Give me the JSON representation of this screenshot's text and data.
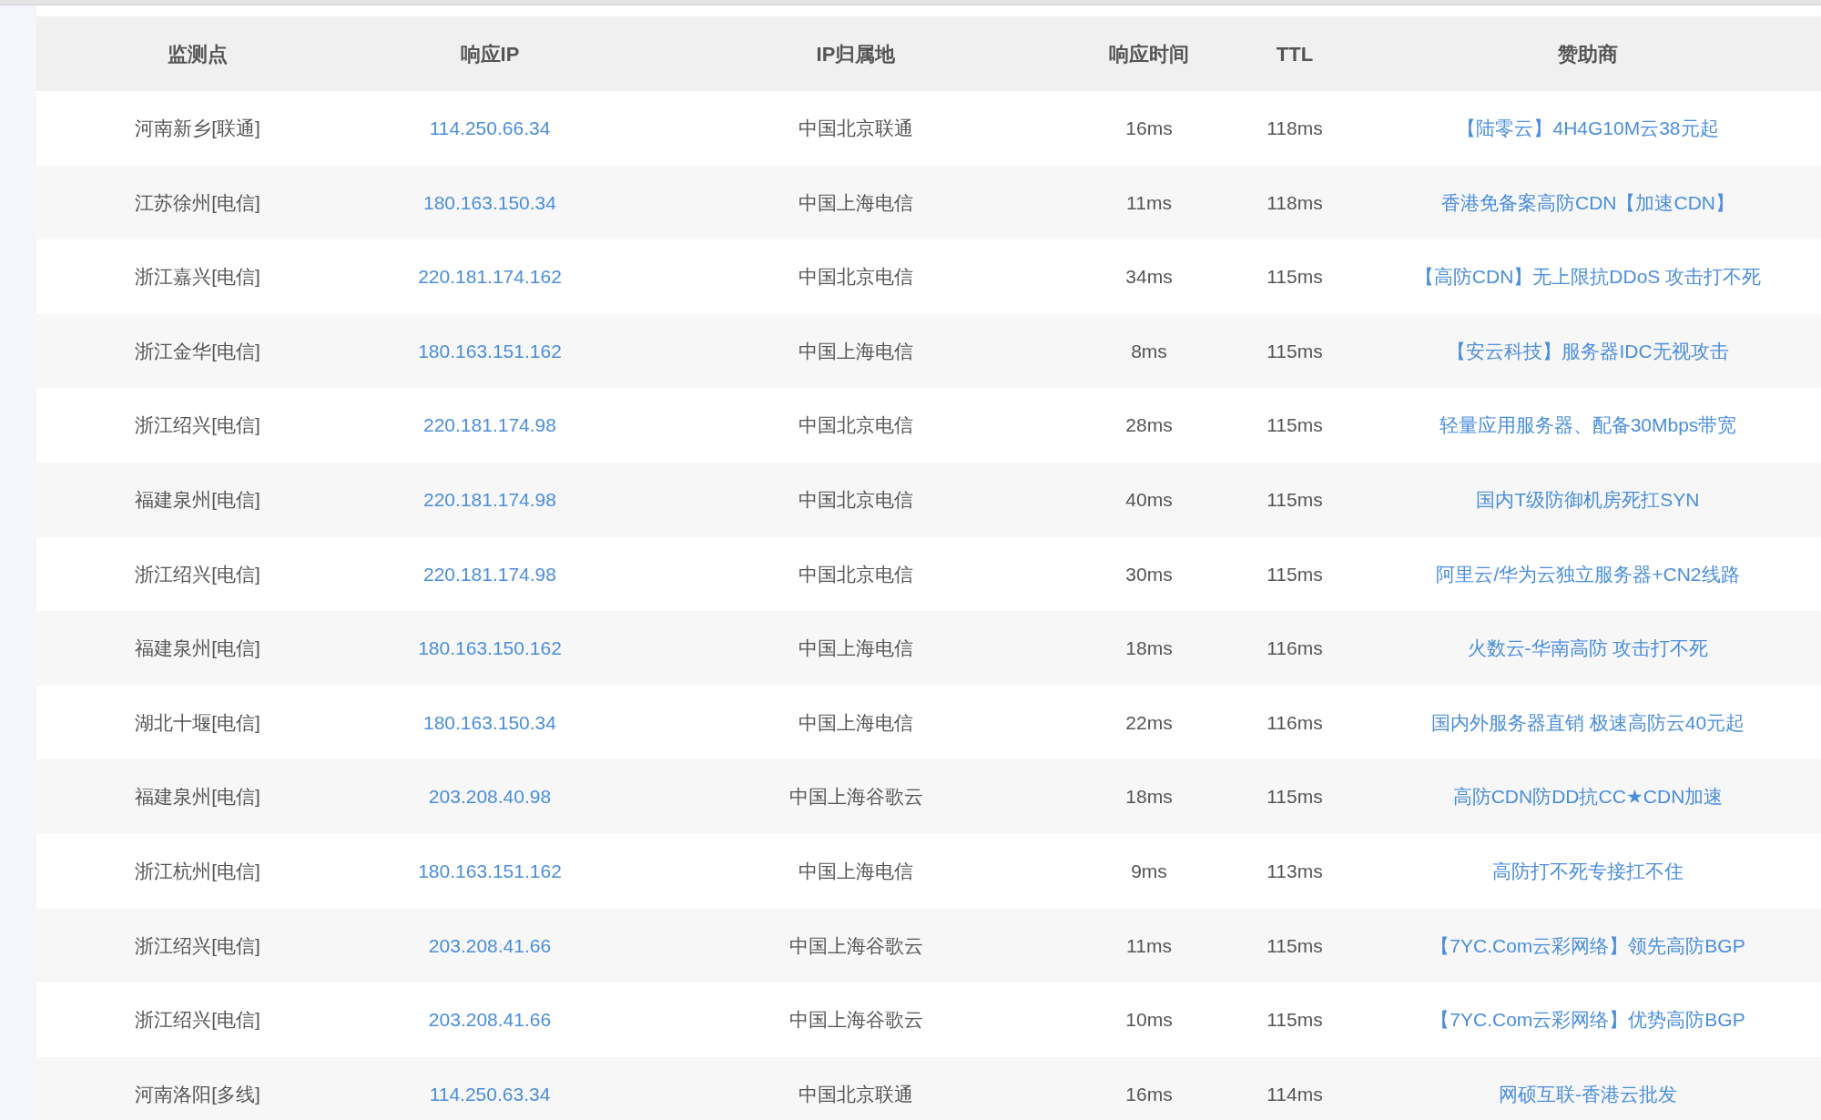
{
  "table": {
    "columns": [
      "监测点",
      "响应IP",
      "IP归属地",
      "响应时间",
      "TTL",
      "赞助商"
    ],
    "rows": [
      {
        "cells": [
          "河南新乡[联通]",
          "114.250.66.34",
          "中国北京联通",
          "16ms",
          "118ms",
          "【陆零云】4H4G10M云38元起"
        ]
      },
      {
        "cells": [
          "江苏徐州[电信]",
          "180.163.150.34",
          "中国上海电信",
          "11ms",
          "118ms",
          "香港免备案高防CDN【加速CDN】"
        ]
      },
      {
        "cells": [
          "浙江嘉兴[电信]",
          "220.181.174.162",
          "中国北京电信",
          "34ms",
          "115ms",
          "【高防CDN】无上限抗DDoS 攻击打不死"
        ]
      },
      {
        "cells": [
          "浙江金华[电信]",
          "180.163.151.162",
          "中国上海电信",
          "8ms",
          "115ms",
          "【安云科技】服务器IDC无视攻击"
        ]
      },
      {
        "cells": [
          "浙江绍兴[电信]",
          "220.181.174.98",
          "中国北京电信",
          "28ms",
          "115ms",
          "轻量应用服务器、配备30Mbps带宽"
        ]
      },
      {
        "cells": [
          "福建泉州[电信]",
          "220.181.174.98",
          "中国北京电信",
          "40ms",
          "115ms",
          "国内T级防御机房死扛SYN"
        ]
      },
      {
        "cells": [
          "浙江绍兴[电信]",
          "220.181.174.98",
          "中国北京电信",
          "30ms",
          "115ms",
          "阿里云/华为云独立服务器+CN2线路"
        ]
      },
      {
        "cells": [
          "福建泉州[电信]",
          "180.163.150.162",
          "中国上海电信",
          "18ms",
          "116ms",
          "火数云-华南高防 攻击打不死"
        ]
      },
      {
        "cells": [
          "湖北十堰[电信]",
          "180.163.150.34",
          "中国上海电信",
          "22ms",
          "116ms",
          "国内外服务器直销 极速高防云40元起"
        ]
      },
      {
        "cells": [
          "福建泉州[电信]",
          "203.208.40.98",
          "中国上海谷歌云",
          "18ms",
          "115ms",
          "高防CDN防DD抗CC★CDN加速"
        ]
      },
      {
        "cells": [
          "浙江杭州[电信]",
          "180.163.151.162",
          "中国上海电信",
          "9ms",
          "113ms",
          "高防打不死专接扛不住"
        ]
      },
      {
        "cells": [
          "浙江绍兴[电信]",
          "203.208.41.66",
          "中国上海谷歌云",
          "11ms",
          "115ms",
          "【7YC.Com云彩网络】领先高防BGP"
        ]
      },
      {
        "cells": [
          "浙江绍兴[电信]",
          "203.208.41.66",
          "中国上海谷歌云",
          "10ms",
          "115ms",
          "【7YC.Com云彩网络】优势高防BGP"
        ]
      },
      {
        "cells": [
          "河南洛阳[多线]",
          "114.250.63.34",
          "中国北京联通",
          "16ms",
          "114ms",
          "网硕互联-香港云批发"
        ]
      }
    ]
  }
}
